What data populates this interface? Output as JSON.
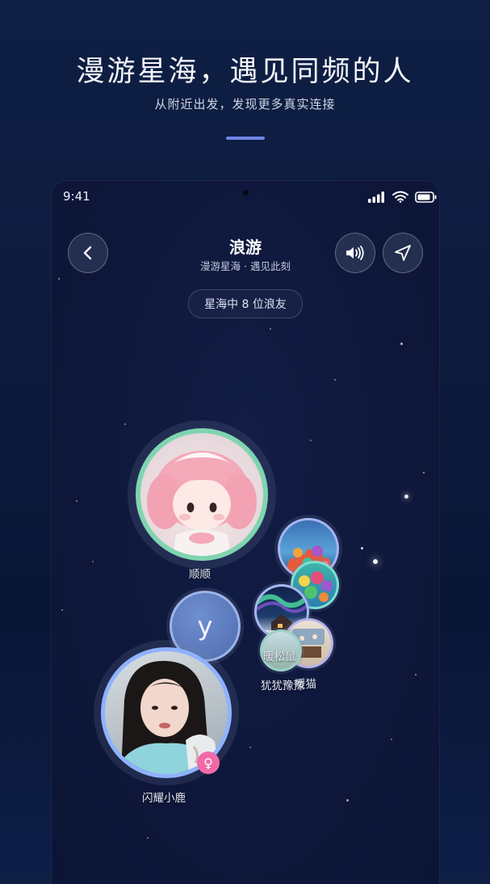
{
  "promo": {
    "headline": "漫游星海，遇见同频的人",
    "subline": "从附近出发，发现更多真实连接"
  },
  "status_bar": {
    "time": "9:41"
  },
  "nav": {
    "title": "浪游",
    "subtitle": "漫游星海 · 遇见此刻",
    "back_icon": "chevron-left-icon",
    "sound_icon": "speaker-icon",
    "locate_icon": "navigation-arrow-icon"
  },
  "online_count_label": "星海中 8 位浪友",
  "users": [
    {
      "name": "顺顺",
      "avatar": "pink-doll-avatar"
    },
    {
      "name": "y",
      "avatar": "letter-avatar",
      "letter": "y"
    },
    {
      "name": "闪耀小鹿",
      "avatar": "girl-photo-avatar",
      "badge": "♀"
    },
    {
      "name": "犹犹豫豫",
      "avatar": "coral-reef-avatar"
    },
    {
      "name": "暖松鼠",
      "avatar": "aurora-cabin-avatar"
    },
    {
      "name": "暖猫",
      "avatar": "cafe-avatar"
    }
  ],
  "colors": {
    "accent": "#6f85e6",
    "badge_female": "#f06aa8",
    "ring_green": "#7fd4b0",
    "ring_blue": "#8fb2ff"
  }
}
